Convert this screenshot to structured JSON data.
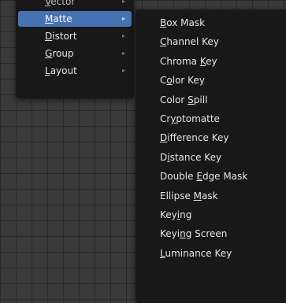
{
  "parent_menu": {
    "items": [
      {
        "label": "Vector",
        "pre": "",
        "key": "V",
        "post": "ector",
        "arrow": "▸",
        "active": false
      },
      {
        "label": "Matte",
        "pre": "",
        "key": "M",
        "post": "atte",
        "arrow": "▸",
        "active": true
      },
      {
        "label": "Distort",
        "pre": "",
        "key": "D",
        "post": "istort",
        "arrow": "▸",
        "active": false
      },
      {
        "label": "Group",
        "pre": "",
        "key": "G",
        "post": "roup",
        "arrow": "▸",
        "active": false
      },
      {
        "label": "Layout",
        "pre": "",
        "key": "L",
        "post": "ayout",
        "arrow": "▸",
        "active": false
      }
    ]
  },
  "sub_menu": {
    "items": [
      {
        "label": "Box Mask",
        "pre": "",
        "key": "B",
        "post": "ox Mask"
      },
      {
        "label": "Channel Key",
        "pre": "",
        "key": "C",
        "post": "hannel Key"
      },
      {
        "label": "Chroma Key",
        "pre": "Chroma ",
        "key": "K",
        "post": "ey"
      },
      {
        "label": "Color Key",
        "pre": "C",
        "key": "o",
        "post": "lor Key"
      },
      {
        "label": "Color Spill",
        "pre": "Color ",
        "key": "S",
        "post": "pill"
      },
      {
        "label": "Cryptomatte",
        "pre": "Cr",
        "key": "y",
        "post": "ptomatte"
      },
      {
        "label": "Difference Key",
        "pre": "",
        "key": "D",
        "post": "ifference Key"
      },
      {
        "label": "Distance Key",
        "pre": "D",
        "key": "i",
        "post": "stance Key"
      },
      {
        "label": "Double Edge Mask",
        "pre": "Double ",
        "key": "E",
        "post": "dge Mask"
      },
      {
        "label": "Ellipse Mask",
        "pre": "Ellipse ",
        "key": "M",
        "post": "ask"
      },
      {
        "label": "Keying",
        "pre": "Key",
        "key": "i",
        "post": "ng"
      },
      {
        "label": "Keying Screen",
        "pre": "Keyi",
        "key": "n",
        "post": "g Screen"
      },
      {
        "label": "Luminance Key",
        "pre": "",
        "key": "L",
        "post": "uminance Key"
      }
    ]
  },
  "colors": {
    "menu_bg": "#181818",
    "highlight": "#4772b3",
    "text": "#e6e6e6",
    "grid_bg": "#3a3a3a"
  }
}
